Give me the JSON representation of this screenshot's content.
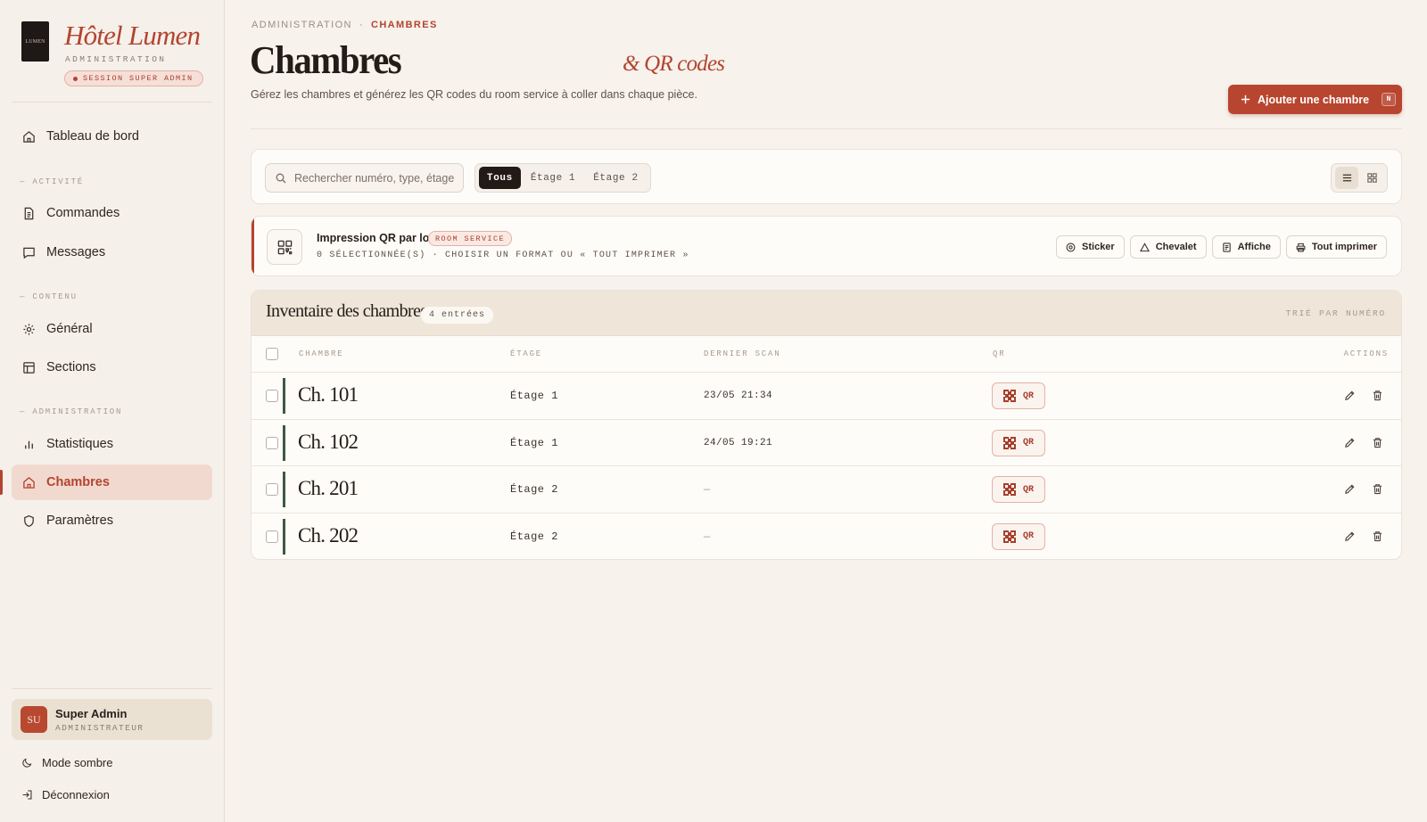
{
  "brand": {
    "logo_text": "LUMEN",
    "name": "Hôtel Lumen",
    "subtitle": "ADMINISTRATION",
    "session_badge": "SESSION SUPER ADMIN"
  },
  "sidebar": {
    "dashboard": "Tableau de bord",
    "sections": [
      "— ACTIVITÉ",
      "— CONTENU",
      "— ADMINISTRATION"
    ],
    "items": [
      {
        "label": "Commandes",
        "icon": "file-icon"
      },
      {
        "label": "Messages",
        "icon": "chat-icon"
      },
      {
        "label": "Général",
        "icon": "gear-icon"
      },
      {
        "label": "Sections",
        "icon": "layout-icon"
      },
      {
        "label": "Statistiques",
        "icon": "bar-chart-icon"
      },
      {
        "label": "Chambres",
        "icon": "home-icon"
      },
      {
        "label": "Paramètres",
        "icon": "shield-icon"
      }
    ],
    "active": "Chambres"
  },
  "user": {
    "initials": "SU",
    "name": "Super Admin",
    "role": "ADMINISTRATEUR"
  },
  "bottom": {
    "dark_mode": "Mode sombre",
    "logout": "Déconnexion"
  },
  "breadcrumb": {
    "root": "ADMINISTRATION",
    "separator": "·",
    "current": "CHAMBRES"
  },
  "header": {
    "title": "Chambres",
    "title_accent": "& QR codes",
    "description": "Gérez les chambres et générez les QR codes du room service à coller dans chaque pièce.",
    "add_button": "Ajouter une chambre",
    "add_shortcut": "N"
  },
  "toolbar": {
    "search_placeholder": "Rechercher numéro, type, étage…",
    "filters": [
      "Tous",
      "Étage 1",
      "Étage 2"
    ],
    "active_filter": "Tous"
  },
  "batch": {
    "title": "Impression QR par lot",
    "badge": "ROOM SERVICE",
    "subtitle": "0 SÉLECTIONNÉE(S) · CHOISIR UN FORMAT OU « TOUT IMPRIMER »",
    "actions": [
      "Sticker",
      "Chevalet",
      "Affiche",
      "Tout imprimer"
    ]
  },
  "inventory": {
    "title": "Inventaire des chambres",
    "count": "4 entrées",
    "sort_label": "TRIÉ PAR NUMÉRO",
    "columns": [
      "CHAMBRE",
      "ÉTAGE",
      "DERNIER SCAN",
      "QR",
      "ACTIONS"
    ],
    "qr_label": "QR",
    "rows": [
      {
        "room": "Ch. 101",
        "floor": "Étage 1",
        "last_scan": "23/05 21:34"
      },
      {
        "room": "Ch. 102",
        "floor": "Étage 1",
        "last_scan": "24/05 19:21"
      },
      {
        "room": "Ch. 201",
        "floor": "Étage 2",
        "last_scan": "—"
      },
      {
        "room": "Ch. 202",
        "floor": "Étage 2",
        "last_scan": "—"
      }
    ]
  },
  "colors": {
    "accent": "#b3442f",
    "background": "#f7f2ec",
    "room_marker": "#3d5a3c"
  }
}
